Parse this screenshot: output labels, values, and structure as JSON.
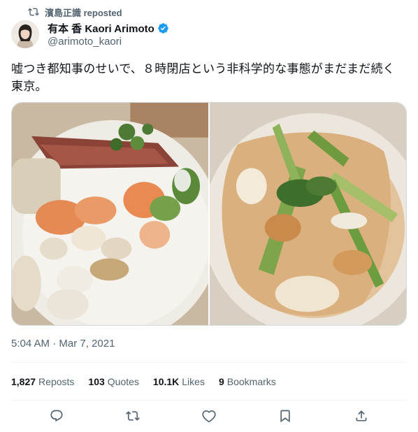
{
  "social_context": {
    "text": "濱島正識 reposted",
    "icon": "repost-icon"
  },
  "author": {
    "display_name": "有本 香 Kaori Arimoto",
    "handle": "@arimoto_kaori",
    "verified": true,
    "verified_color": "#1d9bf0"
  },
  "tweet": {
    "text": "嘘つき都知事のせいで、８時閉店という非科学的な事態がまだまだ続く東京。",
    "timestamp": "5:04 AM · Mar 7, 2021"
  },
  "stats": [
    {
      "count": "1,827",
      "label": "Reposts"
    },
    {
      "count": "103",
      "label": "Quotes"
    },
    {
      "count": "10.1K",
      "label": "Likes"
    },
    {
      "count": "9",
      "label": "Bookmarks"
    }
  ],
  "actions": [
    {
      "icon": "reply-icon"
    },
    {
      "icon": "repost-icon"
    },
    {
      "icon": "like-icon"
    },
    {
      "icon": "bookmark-icon"
    },
    {
      "icon": "share-icon"
    }
  ],
  "colors": {
    "text_primary": "#0f1419",
    "text_secondary": "#536471",
    "divider": "#eff3f4",
    "accent": "#1d9bf0"
  }
}
